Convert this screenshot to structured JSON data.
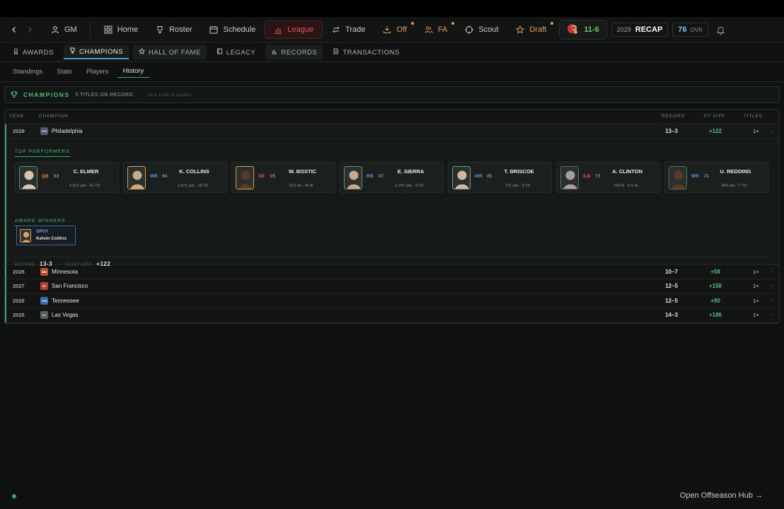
{
  "nav": {
    "gm": "GM",
    "items": [
      {
        "label": "Home"
      },
      {
        "label": "Roster"
      },
      {
        "label": "Schedule"
      },
      {
        "label": "League"
      },
      {
        "label": "Trade"
      },
      {
        "label": "Off"
      },
      {
        "label": "FA"
      },
      {
        "label": "Scout"
      },
      {
        "label": "Draft"
      }
    ],
    "team_record": "11-6",
    "recap_year": "2029",
    "recap_label": "RECAP",
    "ovr_value": "76",
    "ovr_label": "OVR"
  },
  "subnav": [
    "AWARDS",
    "CHAMPIONS",
    "HALL OF FAME",
    "LEGACY",
    "RECORDS",
    "TRANSACTIONS"
  ],
  "tabs": [
    "Standings",
    "Stats",
    "Players",
    "History"
  ],
  "champions": {
    "title": "CHAMPIONS",
    "count": "5 TITLES ON RECORD",
    "hint": "Click a row to expand"
  },
  "table": {
    "headers": {
      "year": "YEAR",
      "champion": "CHAMPION",
      "record": "RECORD",
      "ptdiff": "PT DIFF",
      "titles": "TITLES"
    },
    "rows": [
      {
        "year": "2029",
        "abbr": "PHI",
        "team": "Philadelphia",
        "record": "13–3",
        "diff": "+122",
        "titles": "1×",
        "color": "#4a5a6a"
      },
      {
        "year": "2028",
        "abbr": "MIN",
        "team": "Minnesota",
        "record": "10–7",
        "diff": "+58",
        "titles": "1×",
        "color": "#b8502a"
      },
      {
        "year": "2027",
        "abbr": "SF",
        "team": "San Francisco",
        "record": "12–5",
        "diff": "+158",
        "titles": "1×",
        "color": "#b8402a"
      },
      {
        "year": "2026",
        "abbr": "TEN",
        "team": "Tennessee",
        "record": "12–5",
        "diff": "+90",
        "titles": "1×",
        "color": "#3a6aa8"
      },
      {
        "year": "2025",
        "abbr": "LV",
        "team": "Las Vegas",
        "record": "14–3",
        "diff": "+186",
        "titles": "1×",
        "color": "#5a5f5c"
      }
    ]
  },
  "expanded": {
    "top_performers_label": "TOP PERFORMERS",
    "performers": [
      {
        "name": "C. ELMER",
        "pos": "QB",
        "ovr": "83",
        "stats": "4,413 yds · 41 TD",
        "pos_color": "#e08a3a",
        "frame": "#6a8a7a",
        "skin": "#d9c6b0"
      },
      {
        "name": "K. COLLINS",
        "pos": "WR",
        "ovr": "94",
        "stats": "1,473 yds · 18 TD",
        "pos_color": "#5a9ae8",
        "frame": "#d7a046",
        "skin": "#c9a888"
      },
      {
        "name": "W. BOSTIC",
        "pos": "DE",
        "ovr": "95",
        "stats": "19.0 sk · 66 tk",
        "pos_color": "#e0574f",
        "frame": "#d7a046",
        "skin": "#5a3a26"
      },
      {
        "name": "E. SIERRA",
        "pos": "RB",
        "ovr": "87",
        "stats": "1,207 yds · 9 TD",
        "pos_color": "#5a9ae8",
        "frame": "#6a8a7a",
        "skin": "#c9a888"
      },
      {
        "name": "T. BRISCOE",
        "pos": "WR",
        "ovr": "85",
        "stats": "715 yds · 6 TD",
        "pos_color": "#5a9ae8",
        "frame": "#6a9a8a",
        "skin": "#d0b89a"
      },
      {
        "name": "A. CLINTON",
        "pos": "ILB",
        "ovr": "73",
        "stats": "165 tk · 5.0 sk",
        "pos_color": "#e0574f",
        "frame": "#5a6a6a",
        "skin": "#a8a098"
      },
      {
        "name": "U. REDDING",
        "pos": "WR",
        "ovr": "73",
        "stats": "643 yds · 7 TD",
        "pos_color": "#5a9ae8",
        "frame": "#5a6a6a",
        "skin": "#5a3a26"
      }
    ],
    "award_winners_label": "AWARD WINNERS",
    "award": {
      "type": "OPOY",
      "name": "Kelvin Collins"
    },
    "record_label": "RECORD",
    "record_value": "13-3",
    "diff_label": "POINT DIFF",
    "diff_value": "+122"
  },
  "footer": {
    "hub_link": "Open Offseason Hub →"
  }
}
